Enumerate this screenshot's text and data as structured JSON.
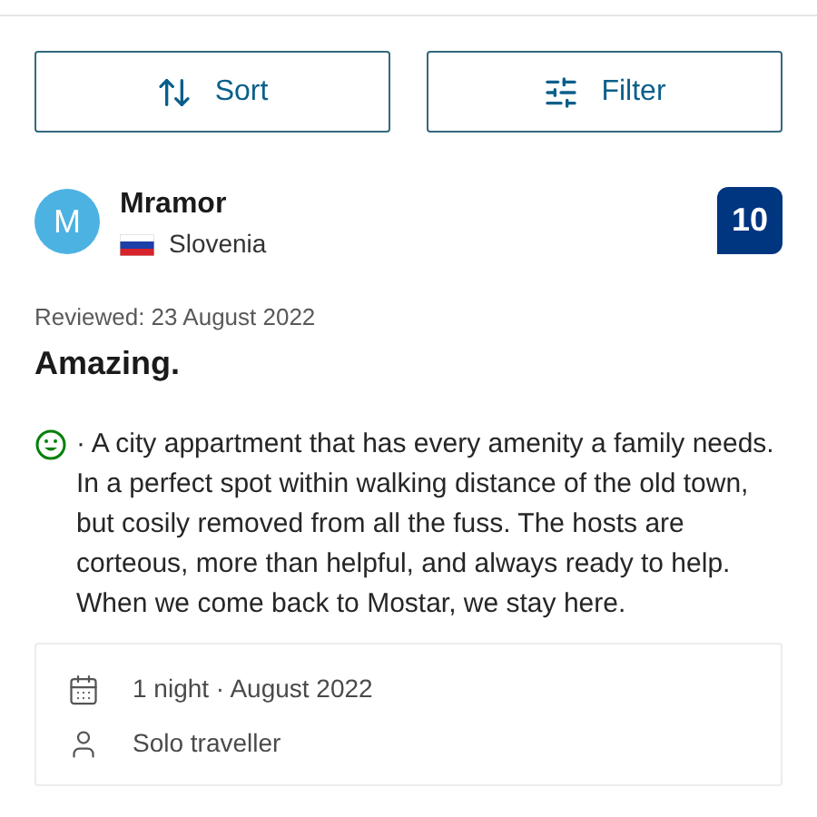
{
  "toolbar": {
    "buttons": [
      {
        "kind": "sort",
        "label": "Sort"
      },
      {
        "kind": "filter",
        "label": "Filter"
      }
    ]
  },
  "review": {
    "reviewer": {
      "initial": "M",
      "name": "Mramor",
      "country": "Slovenia"
    },
    "score": "10",
    "reviewed": "Reviewed: 23 August 2022",
    "title": "Amazing.",
    "body": "· A city appartment that has every amenity a family needs. In a perfect spot within walking distance of the old town, but cosily removed from all the fuss. The hosts are corteous, more than helpful, and always ready to help. When we come back to Mostar, we stay here.",
    "stay": [
      {
        "kind": "calendar",
        "text": "1 night · August 2022"
      },
      {
        "kind": "person",
        "text": "Solo traveller"
      }
    ]
  }
}
